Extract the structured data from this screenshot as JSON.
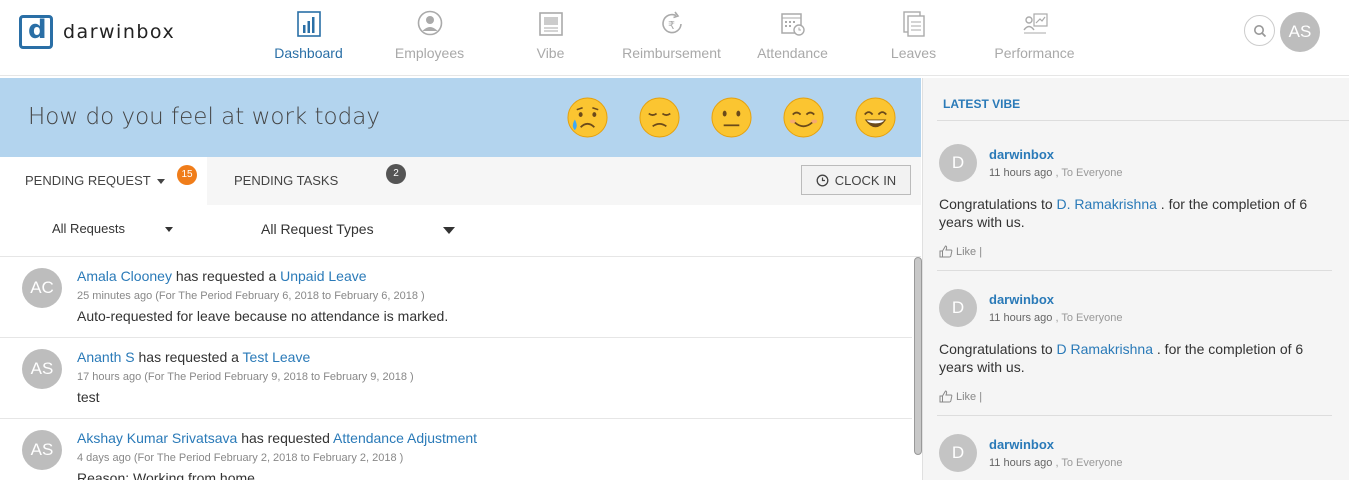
{
  "brand": {
    "name": "darwinbox"
  },
  "nav": [
    {
      "label": "Dashboard",
      "icon": "bar-chart-icon",
      "active": true
    },
    {
      "label": "Employees",
      "icon": "user-circle-icon"
    },
    {
      "label": "Vibe",
      "icon": "newspaper-icon"
    },
    {
      "label": "Reimbursement",
      "icon": "rupee-refresh-icon"
    },
    {
      "label": "Attendance",
      "icon": "calendar-clock-icon"
    },
    {
      "label": "Leaves",
      "icon": "document-stack-icon"
    },
    {
      "label": "Performance",
      "icon": "growth-chart-icon"
    }
  ],
  "user": {
    "initials": "AS"
  },
  "mood": {
    "prompt": "How do you feel at work today"
  },
  "tabs": {
    "pending_request": {
      "label": "PENDING REQUEST",
      "count": "15",
      "color": "#f07d1a"
    },
    "pending_tasks": {
      "label": "PENDING TASKS",
      "count": "2",
      "color": "#555555"
    },
    "clock_in": "CLOCK IN"
  },
  "filters": {
    "requests": "All Requests",
    "types": "All Request Types"
  },
  "requests": [
    {
      "initials": "AC",
      "name": "Amala Clooney",
      "verb": "has requested a",
      "type": "Unpaid Leave",
      "meta": "25 minutes ago (For The Period February 6, 2018 to February 6, 2018 )",
      "body": "Auto-requested for leave because no attendance is marked."
    },
    {
      "initials": "AS",
      "name": "Ananth S",
      "verb": "has requested a",
      "type": "Test Leave",
      "meta": "17 hours ago (For The Period February 9, 2018 to February 9, 2018 )",
      "body": "test"
    },
    {
      "initials": "AS",
      "name": "Akshay Kumar Srivatsava",
      "verb": "has requested",
      "type": "Attendance Adjustment",
      "meta": "4 days ago (For The Period February 2, 2018 to February 2, 2018 )",
      "body_label": "Reason",
      "body": ": Working from home"
    }
  ],
  "vibe": {
    "heading": "LATEST VIBE",
    "posts": [
      {
        "initial": "D",
        "author": "darwinbox",
        "time": "11 hours ago",
        "audience": ", To Everyone",
        "pre": "Congratulations to ",
        "mention": "D. Ramakrishna",
        "post": " . for the completion of 6 years with us.",
        "like": "Like",
        "sep": "|"
      },
      {
        "initial": "D",
        "author": "darwinbox",
        "time": "11 hours ago",
        "audience": ", To Everyone",
        "pre": "Congratulations to ",
        "mention": "D Ramakrishna",
        "post": " . for the completion of 6 years with us.",
        "like": "Like",
        "sep": "|"
      },
      {
        "initial": "D",
        "author": "darwinbox",
        "time": "11 hours ago",
        "audience": ", To Everyone"
      }
    ]
  },
  "colors": {
    "accent": "#2a7ab8",
    "mood_bg": "#b3d4ee"
  }
}
